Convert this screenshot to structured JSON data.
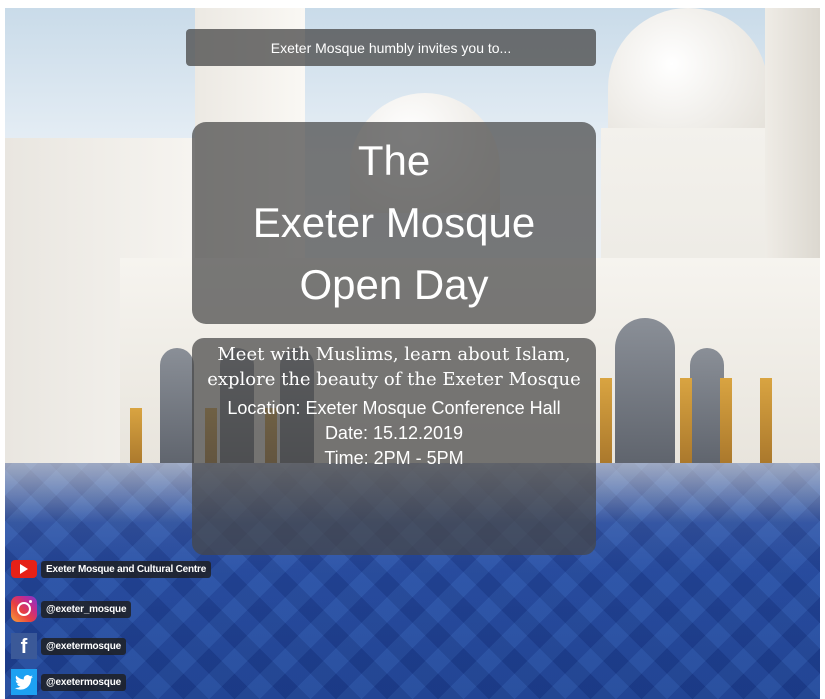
{
  "invite": {
    "text": "Exeter Mosque humbly invites you to..."
  },
  "title": {
    "line1": "The",
    "line2": "Exeter Mosque",
    "line3": "Open Day"
  },
  "details": {
    "tagline": "Meet with Muslims, learn about Islam, explore the beauty of the Exeter Mosque",
    "location": "Location: Exeter Mosque Conference Hall",
    "date": "Date: 15.12.2019",
    "time": "Time: 2PM - 5PM"
  },
  "social": {
    "youtube": {
      "label": "Exeter Mosque and Cultural Centre",
      "icon": "youtube-icon"
    },
    "instagram": {
      "label": "@exeter_mosque",
      "icon": "instagram-icon"
    },
    "facebook": {
      "label": "@exetermosque",
      "icon": "facebook-icon"
    },
    "twitter": {
      "label": "@exetermosque",
      "icon": "twitter-icon"
    }
  },
  "colors": {
    "overlay": "#4b4b4b",
    "youtube": "#e62117",
    "facebook": "#3b5998",
    "twitter": "#1da1f2"
  }
}
